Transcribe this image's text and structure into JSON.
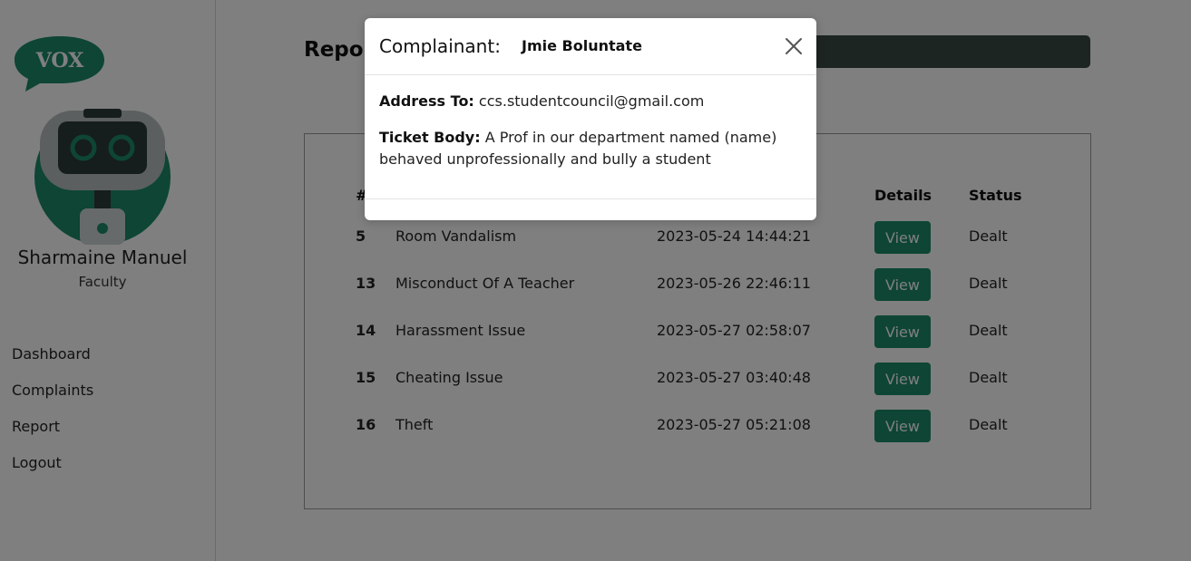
{
  "sidebar": {
    "logo_text": "VOX",
    "user_name": "Sharmaine Manuel",
    "user_role": "Faculty",
    "nav": [
      "Dashboard",
      "Complaints",
      "Report",
      "Logout"
    ]
  },
  "main": {
    "title": "Repor",
    "table": {
      "headers": {
        "id": "#",
        "details": "Details",
        "status": "Status"
      },
      "rows": [
        {
          "id": "5",
          "subject": "Room Vandalism",
          "date": "2023-05-24 14:44:21",
          "action": "View",
          "status": "Dealt"
        },
        {
          "id": "13",
          "subject": "Misconduct Of A Teacher",
          "date": "2023-05-26 22:46:11",
          "action": "View",
          "status": "Dealt"
        },
        {
          "id": "14",
          "subject": "Harassment Issue",
          "date": "2023-05-27 02:58:07",
          "action": "View",
          "status": "Dealt"
        },
        {
          "id": "15",
          "subject": "Cheating Issue",
          "date": "2023-05-27 03:40:48",
          "action": "View",
          "status": "Dealt"
        },
        {
          "id": "16",
          "subject": "Theft",
          "date": "2023-05-27 05:21:08",
          "action": "View",
          "status": "Dealt"
        }
      ]
    }
  },
  "modal": {
    "title_label": "Complainant:",
    "complainant": "Jmie Boluntate",
    "address_label": "Address To:",
    "address_value": "ccs.studentcouncil@gmail.com",
    "ticket_label": "Ticket Body:",
    "ticket_value": "A Prof in our department named (name) behaved unprofessionally and bully a student"
  },
  "colors": {
    "brand_green": "#1c8a68",
    "search_bar": "#3a4a47",
    "overlay": "rgba(0,0,0,0.5)"
  }
}
